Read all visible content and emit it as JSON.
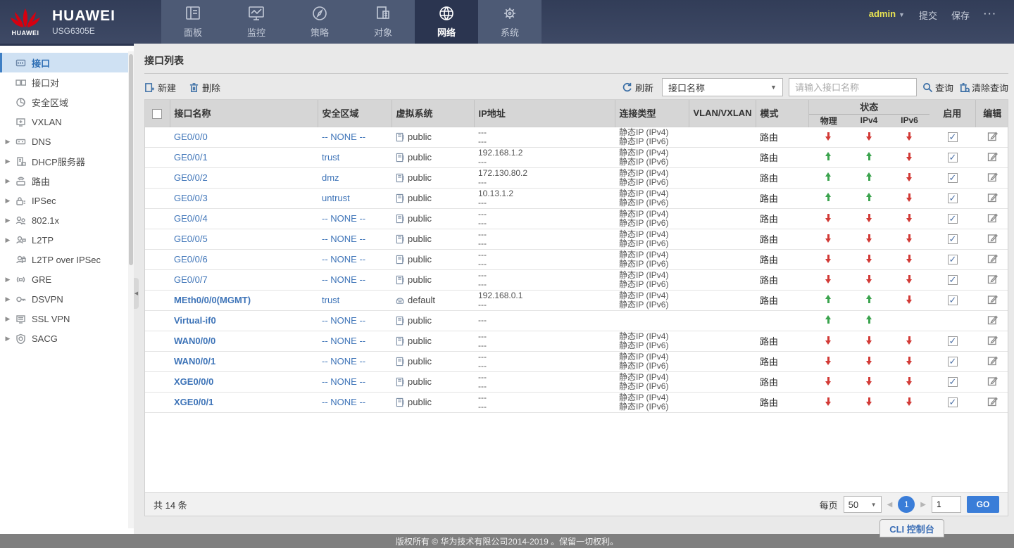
{
  "topbar": {
    "brand": {
      "logo_word": "HUAWEI",
      "name": "HUAWEI",
      "model": "USG6305E"
    },
    "nav": [
      {
        "label": "面板",
        "icon": "dashboard-icon",
        "active": false
      },
      {
        "label": "监控",
        "icon": "monitor-icon",
        "active": false
      },
      {
        "label": "策略",
        "icon": "policy-icon",
        "active": false
      },
      {
        "label": "对象",
        "icon": "object-icon",
        "active": false
      },
      {
        "label": "网络",
        "icon": "network-icon",
        "active": true
      },
      {
        "label": "系统",
        "icon": "system-icon",
        "active": false
      }
    ],
    "user": "admin",
    "submit_label": "提交",
    "save_label": "保存",
    "more_label": "···"
  },
  "sidebar": {
    "items": [
      {
        "label": "接口",
        "icon": "interface-icon",
        "expandable": false,
        "active": true
      },
      {
        "label": "接口对",
        "icon": "interface-pair-icon",
        "expandable": false,
        "active": false
      },
      {
        "label": "安全区域",
        "icon": "security-zone-icon",
        "expandable": false,
        "active": false
      },
      {
        "label": "VXLAN",
        "icon": "vxlan-icon",
        "expandable": false,
        "active": false
      },
      {
        "label": "DNS",
        "icon": "dns-icon",
        "expandable": true,
        "active": false
      },
      {
        "label": "DHCP服务器",
        "icon": "dhcp-server-icon",
        "expandable": true,
        "active": false
      },
      {
        "label": "路由",
        "icon": "route-icon",
        "expandable": true,
        "active": false
      },
      {
        "label": "IPSec",
        "icon": "ipsec-icon",
        "expandable": true,
        "active": false
      },
      {
        "label": "802.1x",
        "icon": "dot1x-icon",
        "expandable": true,
        "active": false
      },
      {
        "label": "L2TP",
        "icon": "l2tp-icon",
        "expandable": true,
        "active": false
      },
      {
        "label": "L2TP over IPSec",
        "icon": "l2tp-over-ipsec-icon",
        "expandable": false,
        "active": false
      },
      {
        "label": "GRE",
        "icon": "gre-icon",
        "expandable": true,
        "active": false
      },
      {
        "label": "DSVPN",
        "icon": "dsvpn-icon",
        "expandable": true,
        "active": false
      },
      {
        "label": "SSL VPN",
        "icon": "ssl-vpn-icon",
        "expandable": true,
        "active": false
      },
      {
        "label": "SACG",
        "icon": "sacg-icon",
        "expandable": true,
        "active": false
      }
    ]
  },
  "page": {
    "title": "接口列表"
  },
  "toolbar": {
    "new_label": "新建",
    "delete_label": "删除",
    "refresh_label": "刷新",
    "filter_selected": "接口名称",
    "search_placeholder": "请输入接口名称",
    "query_label": "查询",
    "clear_label": "清除查询"
  },
  "table": {
    "headers": {
      "name": "接口名称",
      "zone": "安全区域",
      "vsys": "虚拟系统",
      "ip": "IP地址",
      "conn": "连接类型",
      "vlan": "VLAN/VXLAN",
      "mode": "模式",
      "status": "状态",
      "phys": "物理",
      "ipv4": "IPv4",
      "ipv6": "IPv6",
      "enable": "启用",
      "edit": "编辑"
    },
    "rows": [
      {
        "name": "GE0/0/0",
        "bold": false,
        "zone": "-- NONE --",
        "vsys": "public",
        "vsys_icon": "vsys-doc-icon",
        "ip": [
          "---",
          "---"
        ],
        "conn": [
          "静态IP (IPv4)",
          "静态IP (IPv6)"
        ],
        "vlan": "",
        "mode": "路由",
        "phys": "down",
        "ipv4": "down",
        "ipv6": "down",
        "enabled": true
      },
      {
        "name": "GE0/0/1",
        "bold": false,
        "zone": "trust",
        "vsys": "public",
        "vsys_icon": "vsys-doc-icon",
        "ip": [
          "192.168.1.2",
          "---"
        ],
        "conn": [
          "静态IP (IPv4)",
          "静态IP (IPv6)"
        ],
        "vlan": "",
        "mode": "路由",
        "phys": "up",
        "ipv4": "up",
        "ipv6": "down",
        "enabled": true
      },
      {
        "name": "GE0/0/2",
        "bold": false,
        "zone": "dmz",
        "vsys": "public",
        "vsys_icon": "vsys-doc-icon",
        "ip": [
          "172.130.80.2",
          "---"
        ],
        "conn": [
          "静态IP (IPv4)",
          "静态IP (IPv6)"
        ],
        "vlan": "",
        "mode": "路由",
        "phys": "up",
        "ipv4": "up",
        "ipv6": "down",
        "enabled": true
      },
      {
        "name": "GE0/0/3",
        "bold": false,
        "zone": "untrust",
        "vsys": "public",
        "vsys_icon": "vsys-doc-icon",
        "ip": [
          "10.13.1.2",
          "---"
        ],
        "conn": [
          "静态IP (IPv4)",
          "静态IP (IPv6)"
        ],
        "vlan": "",
        "mode": "路由",
        "phys": "up",
        "ipv4": "up",
        "ipv6": "down",
        "enabled": true
      },
      {
        "name": "GE0/0/4",
        "bold": false,
        "zone": "-- NONE --",
        "vsys": "public",
        "vsys_icon": "vsys-doc-icon",
        "ip": [
          "---",
          "---"
        ],
        "conn": [
          "静态IP (IPv4)",
          "静态IP (IPv6)"
        ],
        "vlan": "",
        "mode": "路由",
        "phys": "down",
        "ipv4": "down",
        "ipv6": "down",
        "enabled": true
      },
      {
        "name": "GE0/0/5",
        "bold": false,
        "zone": "-- NONE --",
        "vsys": "public",
        "vsys_icon": "vsys-doc-icon",
        "ip": [
          "---",
          "---"
        ],
        "conn": [
          "静态IP (IPv4)",
          "静态IP (IPv6)"
        ],
        "vlan": "",
        "mode": "路由",
        "phys": "down",
        "ipv4": "down",
        "ipv6": "down",
        "enabled": true
      },
      {
        "name": "GE0/0/6",
        "bold": false,
        "zone": "-- NONE --",
        "vsys": "public",
        "vsys_icon": "vsys-doc-icon",
        "ip": [
          "---",
          "---"
        ],
        "conn": [
          "静态IP (IPv4)",
          "静态IP (IPv6)"
        ],
        "vlan": "",
        "mode": "路由",
        "phys": "down",
        "ipv4": "down",
        "ipv6": "down",
        "enabled": true
      },
      {
        "name": "GE0/0/7",
        "bold": false,
        "zone": "-- NONE --",
        "vsys": "public",
        "vsys_icon": "vsys-doc-icon",
        "ip": [
          "---",
          "---"
        ],
        "conn": [
          "静态IP (IPv4)",
          "静态IP (IPv6)"
        ],
        "vlan": "",
        "mode": "路由",
        "phys": "down",
        "ipv4": "down",
        "ipv6": "down",
        "enabled": true
      },
      {
        "name": "MEth0/0/0(MGMT)",
        "bold": true,
        "zone": "trust",
        "vsys": "default",
        "vsys_icon": "vsys-default-icon",
        "ip": [
          "192.168.0.1",
          "---"
        ],
        "conn": [
          "静态IP (IPv4)",
          "静态IP (IPv6)"
        ],
        "vlan": "",
        "mode": "路由",
        "phys": "up",
        "ipv4": "up",
        "ipv6": "down",
        "enabled": true
      },
      {
        "name": "Virtual-if0",
        "bold": true,
        "zone": "-- NONE --",
        "vsys": "public",
        "vsys_icon": "vsys-doc-icon",
        "ip": [
          "---"
        ],
        "conn": [],
        "vlan": "",
        "mode": "",
        "phys": "up",
        "ipv4": "up",
        "ipv6": "",
        "enabled": null
      },
      {
        "name": "WAN0/0/0",
        "bold": true,
        "zone": "-- NONE --",
        "vsys": "public",
        "vsys_icon": "vsys-doc-icon",
        "ip": [
          "---",
          "---"
        ],
        "conn": [
          "静态IP (IPv4)",
          "静态IP (IPv6)"
        ],
        "vlan": "",
        "mode": "路由",
        "phys": "down",
        "ipv4": "down",
        "ipv6": "down",
        "enabled": true
      },
      {
        "name": "WAN0/0/1",
        "bold": true,
        "zone": "-- NONE --",
        "vsys": "public",
        "vsys_icon": "vsys-doc-icon",
        "ip": [
          "---",
          "---"
        ],
        "conn": [
          "静态IP (IPv4)",
          "静态IP (IPv6)"
        ],
        "vlan": "",
        "mode": "路由",
        "phys": "down",
        "ipv4": "down",
        "ipv6": "down",
        "enabled": true
      },
      {
        "name": "XGE0/0/0",
        "bold": true,
        "zone": "-- NONE --",
        "vsys": "public",
        "vsys_icon": "vsys-doc-icon",
        "ip": [
          "---",
          "---"
        ],
        "conn": [
          "静态IP (IPv4)",
          "静态IP (IPv6)"
        ],
        "vlan": "",
        "mode": "路由",
        "phys": "down",
        "ipv4": "down",
        "ipv6": "down",
        "enabled": true
      },
      {
        "name": "XGE0/0/1",
        "bold": true,
        "zone": "-- NONE --",
        "vsys": "public",
        "vsys_icon": "vsys-doc-icon",
        "ip": [
          "---",
          "---"
        ],
        "conn": [
          "静态IP (IPv4)",
          "静态IP (IPv6)"
        ],
        "vlan": "",
        "mode": "路由",
        "phys": "down",
        "ipv4": "down",
        "ipv6": "down",
        "enabled": true
      }
    ]
  },
  "footer": {
    "total": "共 14 条",
    "per_page_label": "每页",
    "per_page": "50",
    "current_page": "1",
    "goto_value": "1",
    "go_label": "GO"
  },
  "cli_button": "CLI 控制台",
  "copyright": "版权所有 © 华为技术有限公司2014-2019 。保留一切权利。",
  "colors": {
    "topbar_bg": "#38435e",
    "nav_strip_bg": "#4d5a75",
    "nav_active_bg": "#2b3550",
    "accent_blue": "#3a7dd8",
    "link_blue": "#3e74b8",
    "status_up_green": "#3aa34d",
    "status_down_red": "#d23a36",
    "admin_yellow": "#e8e352",
    "huawei_red": "#d6000f"
  }
}
